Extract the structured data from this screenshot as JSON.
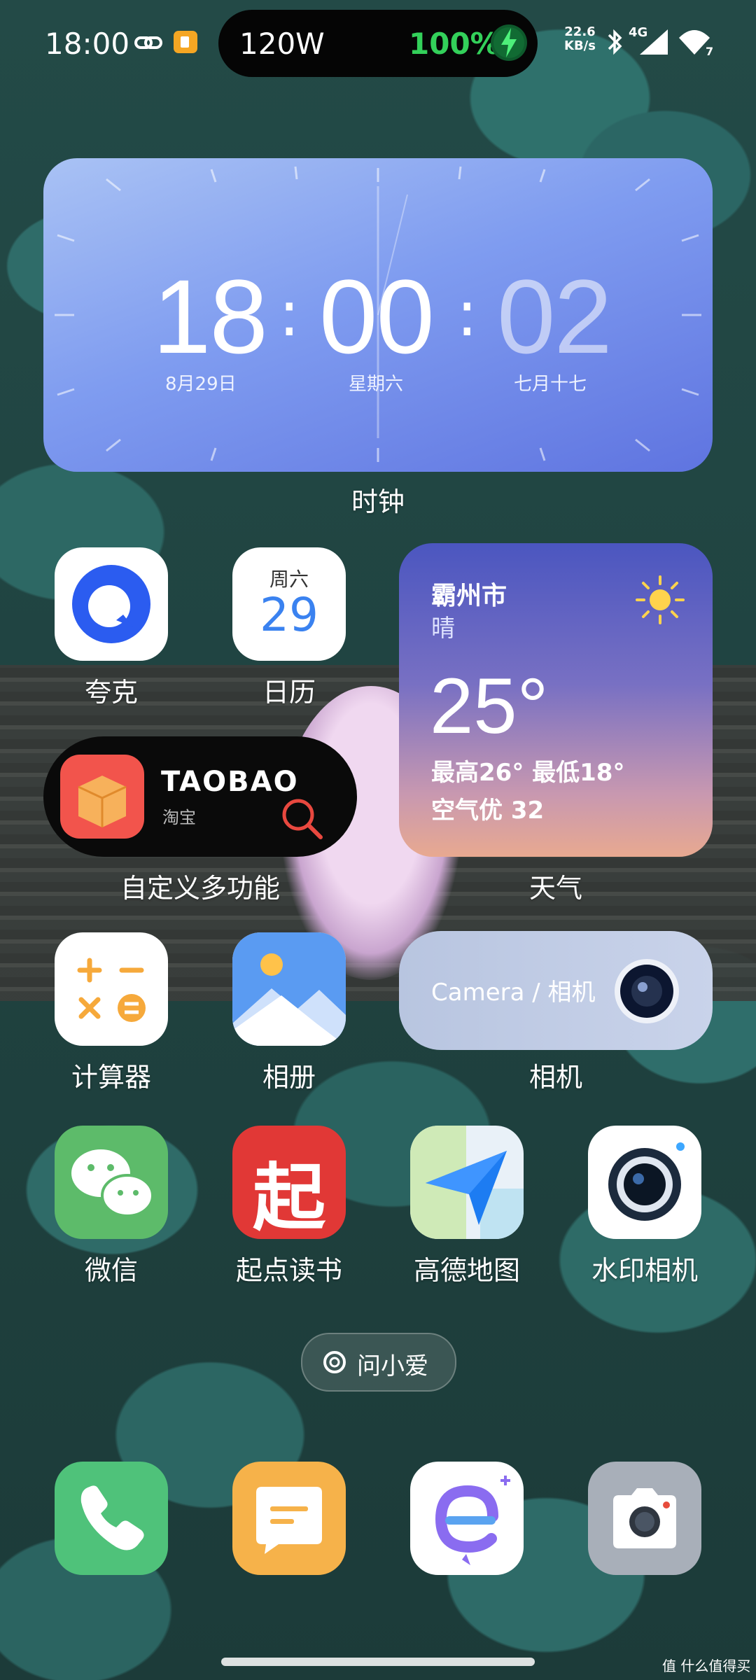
{
  "status_bar": {
    "time": "18:00",
    "charge_power": "120W",
    "battery": "100%",
    "net_speed_value": "22.6",
    "net_speed_unit": "KB/s",
    "network_type": "4G",
    "wifi_badge": "7"
  },
  "clock_widget": {
    "hour": "18",
    "minute": "00",
    "second": "02",
    "date": "8月29日",
    "weekday": "星期六",
    "lunar_date": "七月十七",
    "label": "时钟"
  },
  "apps": {
    "quark": "夸克",
    "calendar": "日历",
    "calendar_weekday": "周六",
    "calendar_day": "29",
    "calculator": "计算器",
    "gallery": "相册",
    "camera_widget_label": "相机",
    "wechat": "微信",
    "qidian": "起点读书",
    "qidian_glyph": "起",
    "amap": "高德地图",
    "watermark_camera": "水印相机"
  },
  "weather_widget": {
    "city": "霸州市",
    "condition": "晴",
    "temperature": "25°",
    "high_low": "最高26° 最低18°",
    "air_quality": "空气优 32",
    "label": "天气"
  },
  "taobao_widget": {
    "brand": "TAOBAO",
    "sub": "淘宝",
    "label": "自定义多功能"
  },
  "camera_widget": {
    "text": "Camera / 相机"
  },
  "assistant": {
    "label": "问小爱"
  },
  "watermark": "值 什么值得买"
}
